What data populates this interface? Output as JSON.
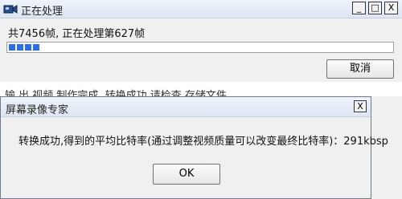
{
  "progress_window": {
    "title": "正在处理",
    "status": "共7456帧, 正在处理第627帧",
    "cancel_label": "取消",
    "frames_total": 7456,
    "frames_done": 627,
    "controls": {
      "minimize": "_",
      "maximize": "□",
      "close": "X"
    },
    "progress_color": "#2d6ee6",
    "icon": "camera-icon"
  },
  "background_strip": {
    "text": "输 出 视频  制作完成,  转换成功  请检查  存储文件"
  },
  "result_dialog": {
    "title": "屏幕录像专家",
    "message": "转换成功,得到的平均比特率(通过调整视频质量可以改变最终比特率)：291kbsp",
    "ok_label": "OK",
    "close_glyph": "X"
  }
}
